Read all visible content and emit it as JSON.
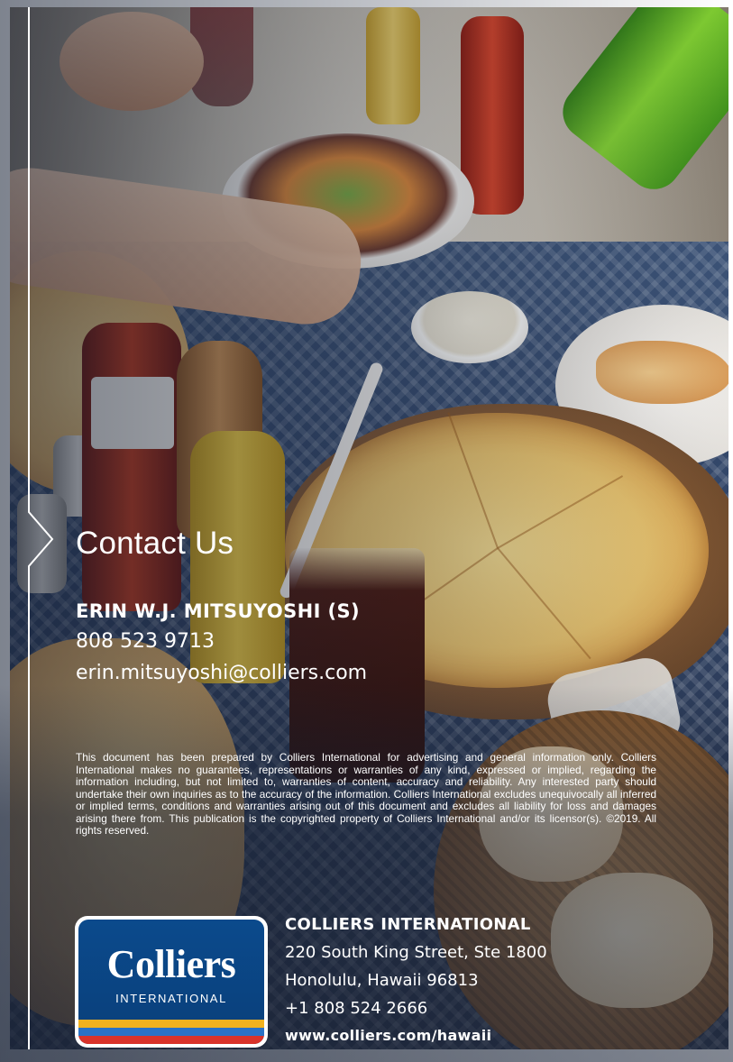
{
  "contact": {
    "title": "Contact Us",
    "name": "ERIN W.J. MITSUYOSHI (S)",
    "phone": "808 523 9713",
    "email": "erin.mitsuyoshi@colliers.com"
  },
  "disclaimer": "This document has been prepared by Colliers International for advertising and general information only. Colliers International makes no guarantees, representations or warranties of any kind, expressed or implied, regarding the information including, but not limited to, warranties of content, accuracy and reliability. Any interested party should undertake their own inquiries as to the accuracy of the information. Colliers International excludes unequivocally all inferred or implied terms, conditions and warranties arising out of this document and excludes all liability for loss and damages arising there from. This publication is the copyrighted property of Colliers International and/or its licensor(s). ©2019. All rights reserved.",
  "logo": {
    "word": "Colliers",
    "sub": "INTERNATIONAL",
    "colors": {
      "blue": "#0b4a8c",
      "yellow": "#f2b21e",
      "blue_light": "#2a72c6",
      "red": "#d9332b"
    }
  },
  "office": {
    "name": "COLLIERS INTERNATIONAL",
    "address1": "220 South King Street, Ste 1800",
    "address2": "Honolulu, Hawaii 96813",
    "phone": "+1 808 524 2666",
    "website": "www.colliers.com/hawaii"
  },
  "icons": {
    "bracket": "chevron-bracket-icon"
  }
}
